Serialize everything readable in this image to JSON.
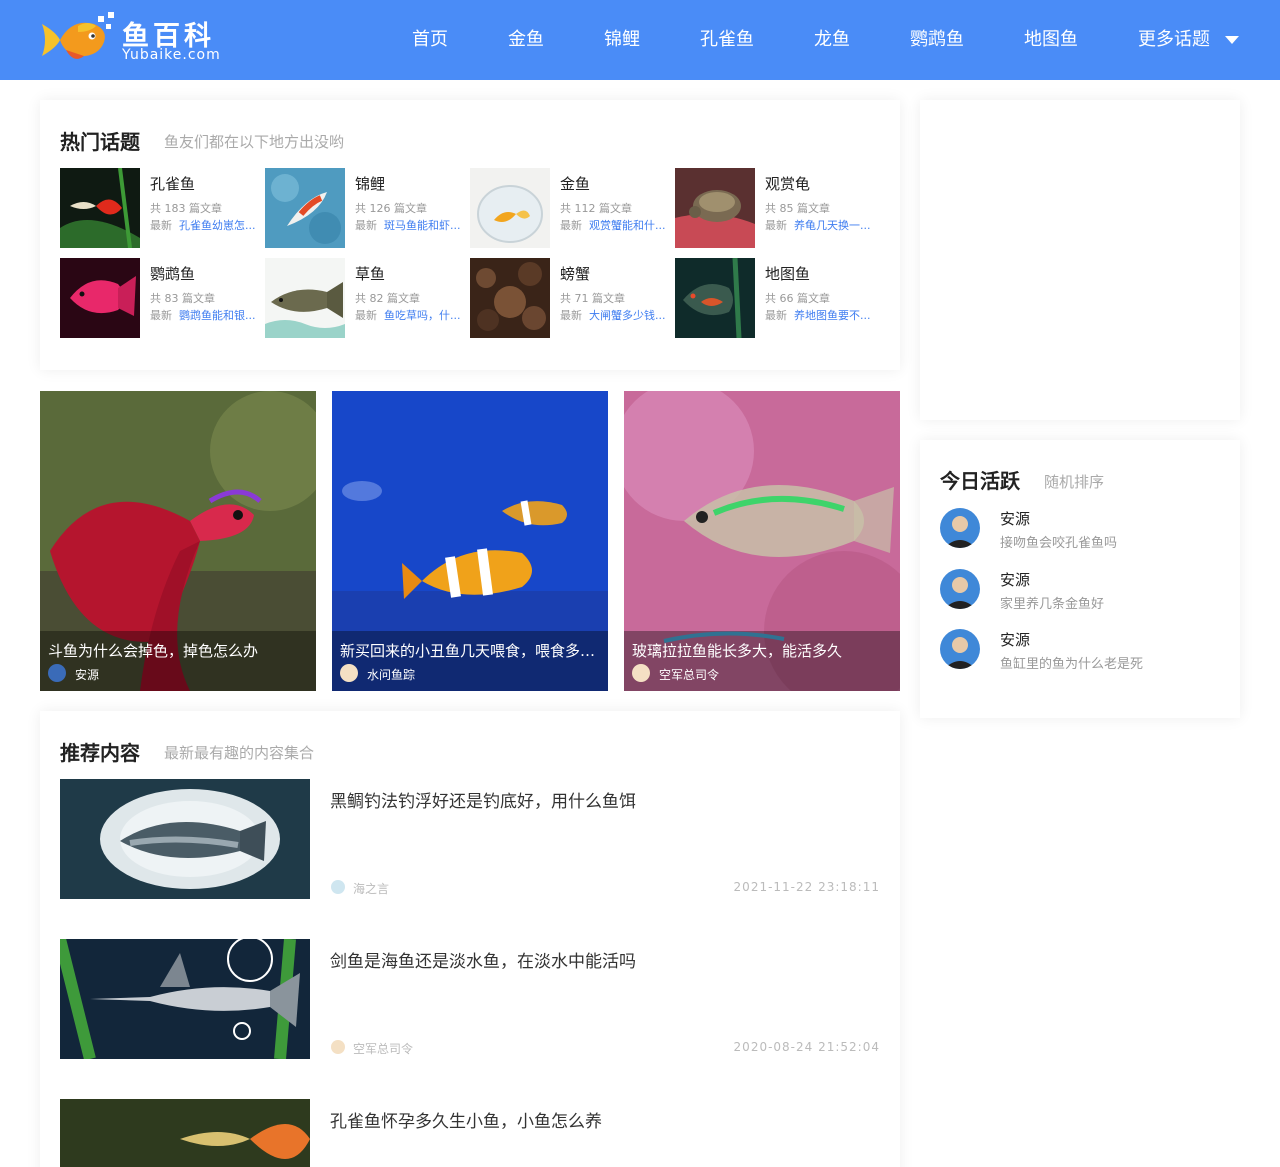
{
  "header": {
    "logo_cn": "鱼百科",
    "logo_en": "Yubaike.com",
    "nav": [
      {
        "label": "首页"
      },
      {
        "label": "金鱼"
      },
      {
        "label": "锦鲤"
      },
      {
        "label": "孔雀鱼"
      },
      {
        "label": "龙鱼"
      },
      {
        "label": "鹦鹉鱼"
      },
      {
        "label": "地图鱼"
      },
      {
        "label": "更多话题"
      }
    ]
  },
  "hot_topics": {
    "title": "热门话题",
    "subtitle": "鱼友们都在以下地方出没哟",
    "latest_label": "最新",
    "items": [
      {
        "name": "孔雀鱼",
        "count": "共 183 篇文章",
        "latest": "孔雀鱼幼崽怎..."
      },
      {
        "name": "锦鲤",
        "count": "共 126 篇文章",
        "latest": "斑马鱼能和虾..."
      },
      {
        "name": "金鱼",
        "count": "共 112 篇文章",
        "latest": "观赏蟹能和什..."
      },
      {
        "name": "观赏龟",
        "count": "共 85 篇文章",
        "latest": "养龟几天换一..."
      },
      {
        "name": "鹦鹉鱼",
        "count": "共 83 篇文章",
        "latest": "鹦鹉鱼能和银..."
      },
      {
        "name": "草鱼",
        "count": "共 82 篇文章",
        "latest": "鱼吃草吗，什..."
      },
      {
        "name": "螃蟹",
        "count": "共 71 篇文章",
        "latest": "大闸蟹多少钱..."
      },
      {
        "name": "地图鱼",
        "count": "共 66 篇文章",
        "latest": "养地图鱼要不..."
      }
    ]
  },
  "featured": [
    {
      "title": "斗鱼为什么会掉色，掉色怎么办",
      "author": "安源"
    },
    {
      "title": "新买回来的小丑鱼几天喂食，喂食多少合适",
      "author": "水问鱼踪"
    },
    {
      "title": "玻璃拉拉鱼能长多大，能活多久",
      "author": "空军总司令"
    }
  ],
  "active_today": {
    "title": "今日活跃",
    "subtitle": "随机排序",
    "users": [
      {
        "name": "安源",
        "desc": "接吻鱼会咬孔雀鱼吗"
      },
      {
        "name": "安源",
        "desc": "家里养几条金鱼好"
      },
      {
        "name": "安源",
        "desc": "鱼缸里的鱼为什么老是死"
      }
    ]
  },
  "recommended": {
    "title": "推荐内容",
    "subtitle": "最新最有趣的内容集合",
    "items": [
      {
        "title": "黑鲷钓法钓浮好还是钓底好，用什么鱼饵",
        "author": "海之言",
        "time": "2021-11-22 23:18:11"
      },
      {
        "title": "剑鱼是海鱼还是淡水鱼，在淡水中能活吗",
        "author": "空军总司令",
        "time": "2020-08-24 21:52:04"
      },
      {
        "title": "孔雀鱼怀孕多久生小鱼，小鱼怎么养",
        "author": "",
        "time": ""
      }
    ]
  },
  "colors": {
    "brand": "#4a8cf7",
    "link": "#3f7df0"
  }
}
